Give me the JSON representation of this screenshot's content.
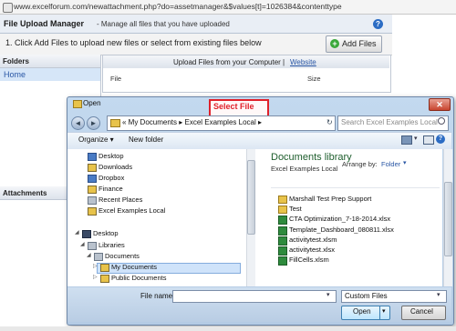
{
  "browser": {
    "url": "www.excelforum.com/newattachment.php?do=assetmanager&$values[t]=1026384&contenttype"
  },
  "upload_manager": {
    "title": "File Upload Manager",
    "subtitle": "- Manage all files that you have uploaded",
    "instruction": "1. Click Add Files to upload new files or select from existing files below",
    "add_files_label": "Add Files",
    "help_label": "?",
    "folders_header": "Folders",
    "home_label": "Home",
    "attachments_header": "Attachments",
    "upload_title": "Upload Files from your Computer",
    "separator": "|",
    "website_link": "Website",
    "file_col": "File",
    "size_col": "Size"
  },
  "dialog": {
    "title": "Open",
    "select_file_label": "Select File",
    "close_glyph": "✕",
    "back_glyph": "◄",
    "fwd_glyph": "►",
    "address": "«  My Documents  ▸  Excel Examples Local  ▸",
    "refresh_glyph": "↻",
    "search_placeholder": "Search Excel Examples Local",
    "organize_label": "Organize ▾",
    "new_folder_label": "New folder",
    "view_chevron": "▾",
    "help_glyph": "?",
    "nav_items": [
      {
        "label": "Desktop",
        "icon": "desktop-icon"
      },
      {
        "label": "Downloads",
        "icon": "downloads-icon"
      },
      {
        "label": "Dropbox",
        "icon": "dropbox-icon"
      },
      {
        "label": "Finance",
        "icon": "folder-icon"
      },
      {
        "label": "Recent Places",
        "icon": "recent-places-icon"
      },
      {
        "label": "Excel Examples Local",
        "icon": "folder-icon"
      },
      {
        "label": "Desktop",
        "icon": "desktop-icon"
      },
      {
        "label": "Libraries",
        "icon": "libraries-icon"
      },
      {
        "label": "Documents",
        "icon": "documents-icon"
      },
      {
        "label": "My Documents",
        "icon": "folder-icon"
      },
      {
        "label": "Public Documents",
        "icon": "folder-icon"
      }
    ],
    "library_title": "Documents library",
    "library_subtitle": "Excel Examples Local",
    "arrange_label": "Arrange by:",
    "arrange_value": "Folder",
    "arrange_chevron": "▾",
    "files": [
      {
        "name": "Marshall Test Prep Support",
        "type": "folder"
      },
      {
        "name": "Test",
        "type": "folder"
      },
      {
        "name": "CTA Optimization_7-18-2014.xlsx",
        "type": "xls"
      },
      {
        "name": "Template_Dashboard_080811.xlsx",
        "type": "xls"
      },
      {
        "name": "activitytest.xlsm",
        "type": "xlsm"
      },
      {
        "name": "activitytest.xlsx",
        "type": "xls"
      },
      {
        "name": "FillCells.xlsm",
        "type": "xlsm"
      }
    ],
    "filename_label": "File name:",
    "filename_value": "",
    "filename_chevron": "▾",
    "filetype_value": "Custom Files",
    "filetype_chevron": "▾",
    "open_label": "Open",
    "open_chevron": "▾",
    "cancel_label": "Cancel"
  }
}
